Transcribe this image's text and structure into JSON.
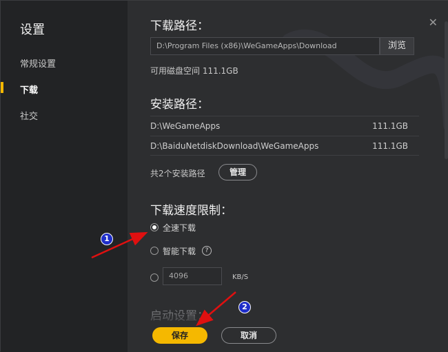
{
  "sidebar": {
    "title": "设置",
    "items": [
      {
        "label": "常规设置"
      },
      {
        "label": "下载"
      },
      {
        "label": "社交"
      }
    ]
  },
  "download_path": {
    "heading": "下载路径：",
    "value": "D:\\Program Files (x86)\\WeGameApps\\Download",
    "browse_label": "浏览",
    "free_space": "可用磁盘空间 111.1GB"
  },
  "install_paths": {
    "heading": "安装路径：",
    "rows": [
      {
        "path": "D:\\WeGameApps",
        "size": "111.1GB"
      },
      {
        "path": "D:\\BaiduNetdiskDownload\\WeGameApps",
        "size": "111.1GB"
      }
    ],
    "count_label": "共2个安装路径",
    "manage_label": "管理"
  },
  "speed_limit": {
    "heading": "下载速度限制：",
    "options": [
      {
        "label": "全速下载",
        "checked": true
      },
      {
        "label": "智能下载",
        "checked": false
      }
    ],
    "custom_value": "4096",
    "unit": "KB/S",
    "help_glyph": "?"
  },
  "startup": {
    "heading": "启动设置："
  },
  "footer": {
    "save_label": "保存",
    "cancel_label": "取消"
  },
  "close_glyph": "✕",
  "annotations": [
    {
      "number": "1"
    },
    {
      "number": "2"
    }
  ],
  "colors": {
    "accent": "#f5b800",
    "arrow": "#e01010",
    "badge": "#1f2ec9"
  }
}
